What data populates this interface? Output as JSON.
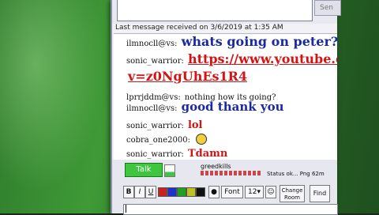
{
  "send_area": {
    "send_label": "Sen"
  },
  "last_message": "Last message received on 3/6/2019 at 1:35 AM",
  "messages": [
    {
      "sender": "ilmnocll@vs:",
      "text": "whats going on peter?"
    },
    {
      "sender": "sonic_warrior:",
      "text": "https://www.youtube.c"
    },
    {
      "continuation": "v=z0NgUhEs1R4"
    },
    {
      "sender": "lprrjddm@vs:",
      "text": "nothing how its going?"
    },
    {
      "sender": "ilmnocll@vs:",
      "text": "good thank you"
    },
    {
      "sender": "sonic_warrior:",
      "text": "lol"
    },
    {
      "sender": "cobra_one2000:",
      "text": ""
    },
    {
      "sender": "sonic_warrior:",
      "text": "Tdamn"
    }
  ],
  "controls": {
    "talk_label": "Talk",
    "speaker_name": "greedkills",
    "status_text": "Status ok... Png 62m",
    "bold": "B",
    "italic": "I",
    "underline": "U",
    "font_label": "Font",
    "font_size": "12",
    "change_room_label": "Change Room",
    "find_label": "Find",
    "colors": [
      "#cc2020",
      "#2030cc",
      "#20a020",
      "#c0c020",
      "#111111"
    ]
  }
}
